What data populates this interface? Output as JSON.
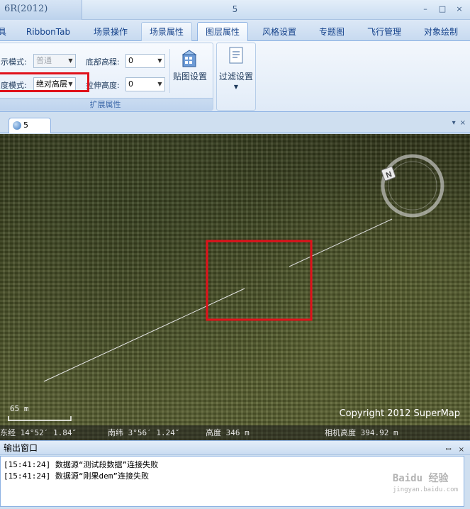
{
  "window": {
    "app_title": "6R(2012)",
    "title": "5",
    "minimize": "–",
    "maximize": "□",
    "close": "×"
  },
  "tabs": [
    {
      "label": "具"
    },
    {
      "label": "RibbonTab"
    },
    {
      "label": "场景操作"
    },
    {
      "label": "场景属性"
    },
    {
      "label": "图层属性"
    },
    {
      "label": "风格设置"
    },
    {
      "label": "专题图"
    },
    {
      "label": "飞行管理"
    },
    {
      "label": "对象绘制"
    }
  ],
  "ribbon": {
    "display_mode_label": "示模式:",
    "display_mode_value": "普通",
    "altitude_mode_label": "度模式:",
    "altitude_mode_value": "绝对高层",
    "bottom_altitude_label": "底部高程:",
    "bottom_altitude_value": "0",
    "extrude_height_label": "拉伸高度:",
    "extrude_height_value": "0",
    "texture_button": "贴图设置",
    "group_caption": "扩展属性",
    "filter_button": "过滤设置"
  },
  "doc": {
    "tab_label": "5",
    "dropdown": "▾",
    "close": "×"
  },
  "scene": {
    "copyright": "Copyright 2012 SuperMap",
    "scale": "65 m",
    "compass_letter": "N",
    "status": {
      "longitude": "东经 14°52′ 1.84″",
      "latitude": "南纬 3°56′ 1.24″",
      "altitude": "高度 346 m",
      "camera_altitude": "相机高度 394.92 m"
    }
  },
  "output": {
    "title": "输出窗口",
    "pin": "ꟷ",
    "close": "×",
    "lines": [
      "[15:41:24] 数据源“测试段数据”连接失败",
      "[15:41:24] 数据源“刚果dem”连接失败"
    ],
    "watermark": "Baidu 经验",
    "watermark_url": "jingyan.baidu.com"
  },
  "colors": {
    "highlight": "#e0121b",
    "ribbon_text": "#15428b",
    "terrain": "#49512a"
  }
}
